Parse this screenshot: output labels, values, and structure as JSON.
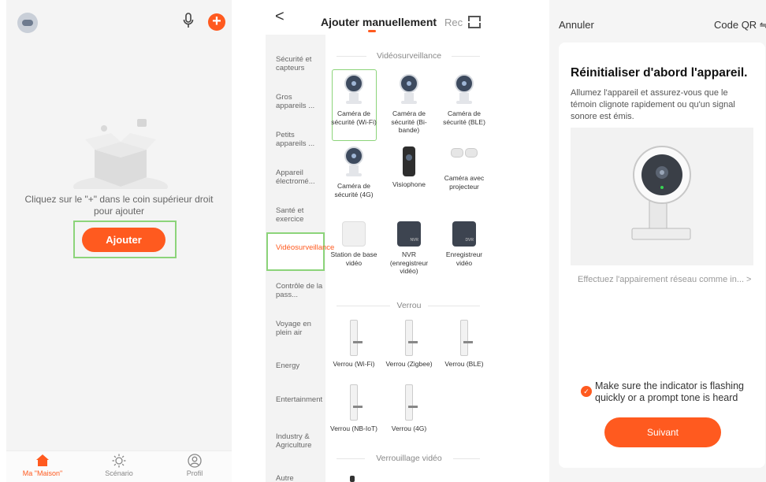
{
  "colors": {
    "accent": "#ff5a1f",
    "highlight_outline": "#8cd47a"
  },
  "home": {
    "empty_text": "Cliquez sur le \"+\" dans le coin supérieur droit pour ajouter",
    "add_button": "Ajouter",
    "icons": {
      "avatar": "robot-avatar",
      "mic": "microphone-icon",
      "add": "plus-icon"
    },
    "tabs": [
      {
        "label": "Ma \"Maison\"",
        "icon": "house-icon",
        "active": true
      },
      {
        "label": "Scénario",
        "icon": "sun-icon",
        "active": false
      },
      {
        "label": "Profil",
        "icon": "profile-icon",
        "active": false
      }
    ]
  },
  "manual": {
    "back": "<",
    "title": "Ajouter manuellement",
    "rec": "Rec",
    "categories": [
      "Sécurité et capteurs",
      "Gros appareils ...",
      "Petits appareils ...",
      "Appareil électromé...",
      "Santé et exercice",
      "Vidéosurveillance",
      "Contrôle de la pass...",
      "Voyage en plein air",
      "Energy",
      "Entertainment",
      "Industry & Agriculture",
      "Autre"
    ],
    "active_category": "Vidéosurveillance",
    "sections": [
      {
        "title": "Vidéosurveillance",
        "devices": [
          "Caméra de sécurité (Wi-Fi)",
          "Caméra de sécurité (Bi-bande)",
          "Caméra de sécurité (BLE)",
          "Caméra de sécurité (4G)",
          "Visiophone",
          "Caméra avec projecteur",
          "Station de base vidéo",
          "NVR (enregistreur vidéo)",
          "Enregistreur vidéo"
        ]
      },
      {
        "title": "Verrou",
        "devices": [
          "Verrou (Wi-Fi)",
          "Verrou (Zigbee)",
          "Verrou (BLE)",
          "Verrou (NB-IoT)",
          "Verrou (4G)"
        ]
      },
      {
        "title": "Verrouillage vidéo",
        "devices": []
      }
    ],
    "nvr_badge": "NVR",
    "dvr_badge": "DVR"
  },
  "reset": {
    "cancel": "Annuler",
    "qr": "Code QR ⇋",
    "heading": "Réinitialiser d'abord l'appareil.",
    "subtitle": "Allumez l'appareil et assurez-vous que le témoin clignote rapidement ou qu'un signal sonore est émis.",
    "pairing_link": "Effectuez l'appairement réseau comme in... >",
    "confirm_text": "Make sure the indicator is flashing quickly or a prompt tone is heard",
    "next_button": "Suivant"
  }
}
